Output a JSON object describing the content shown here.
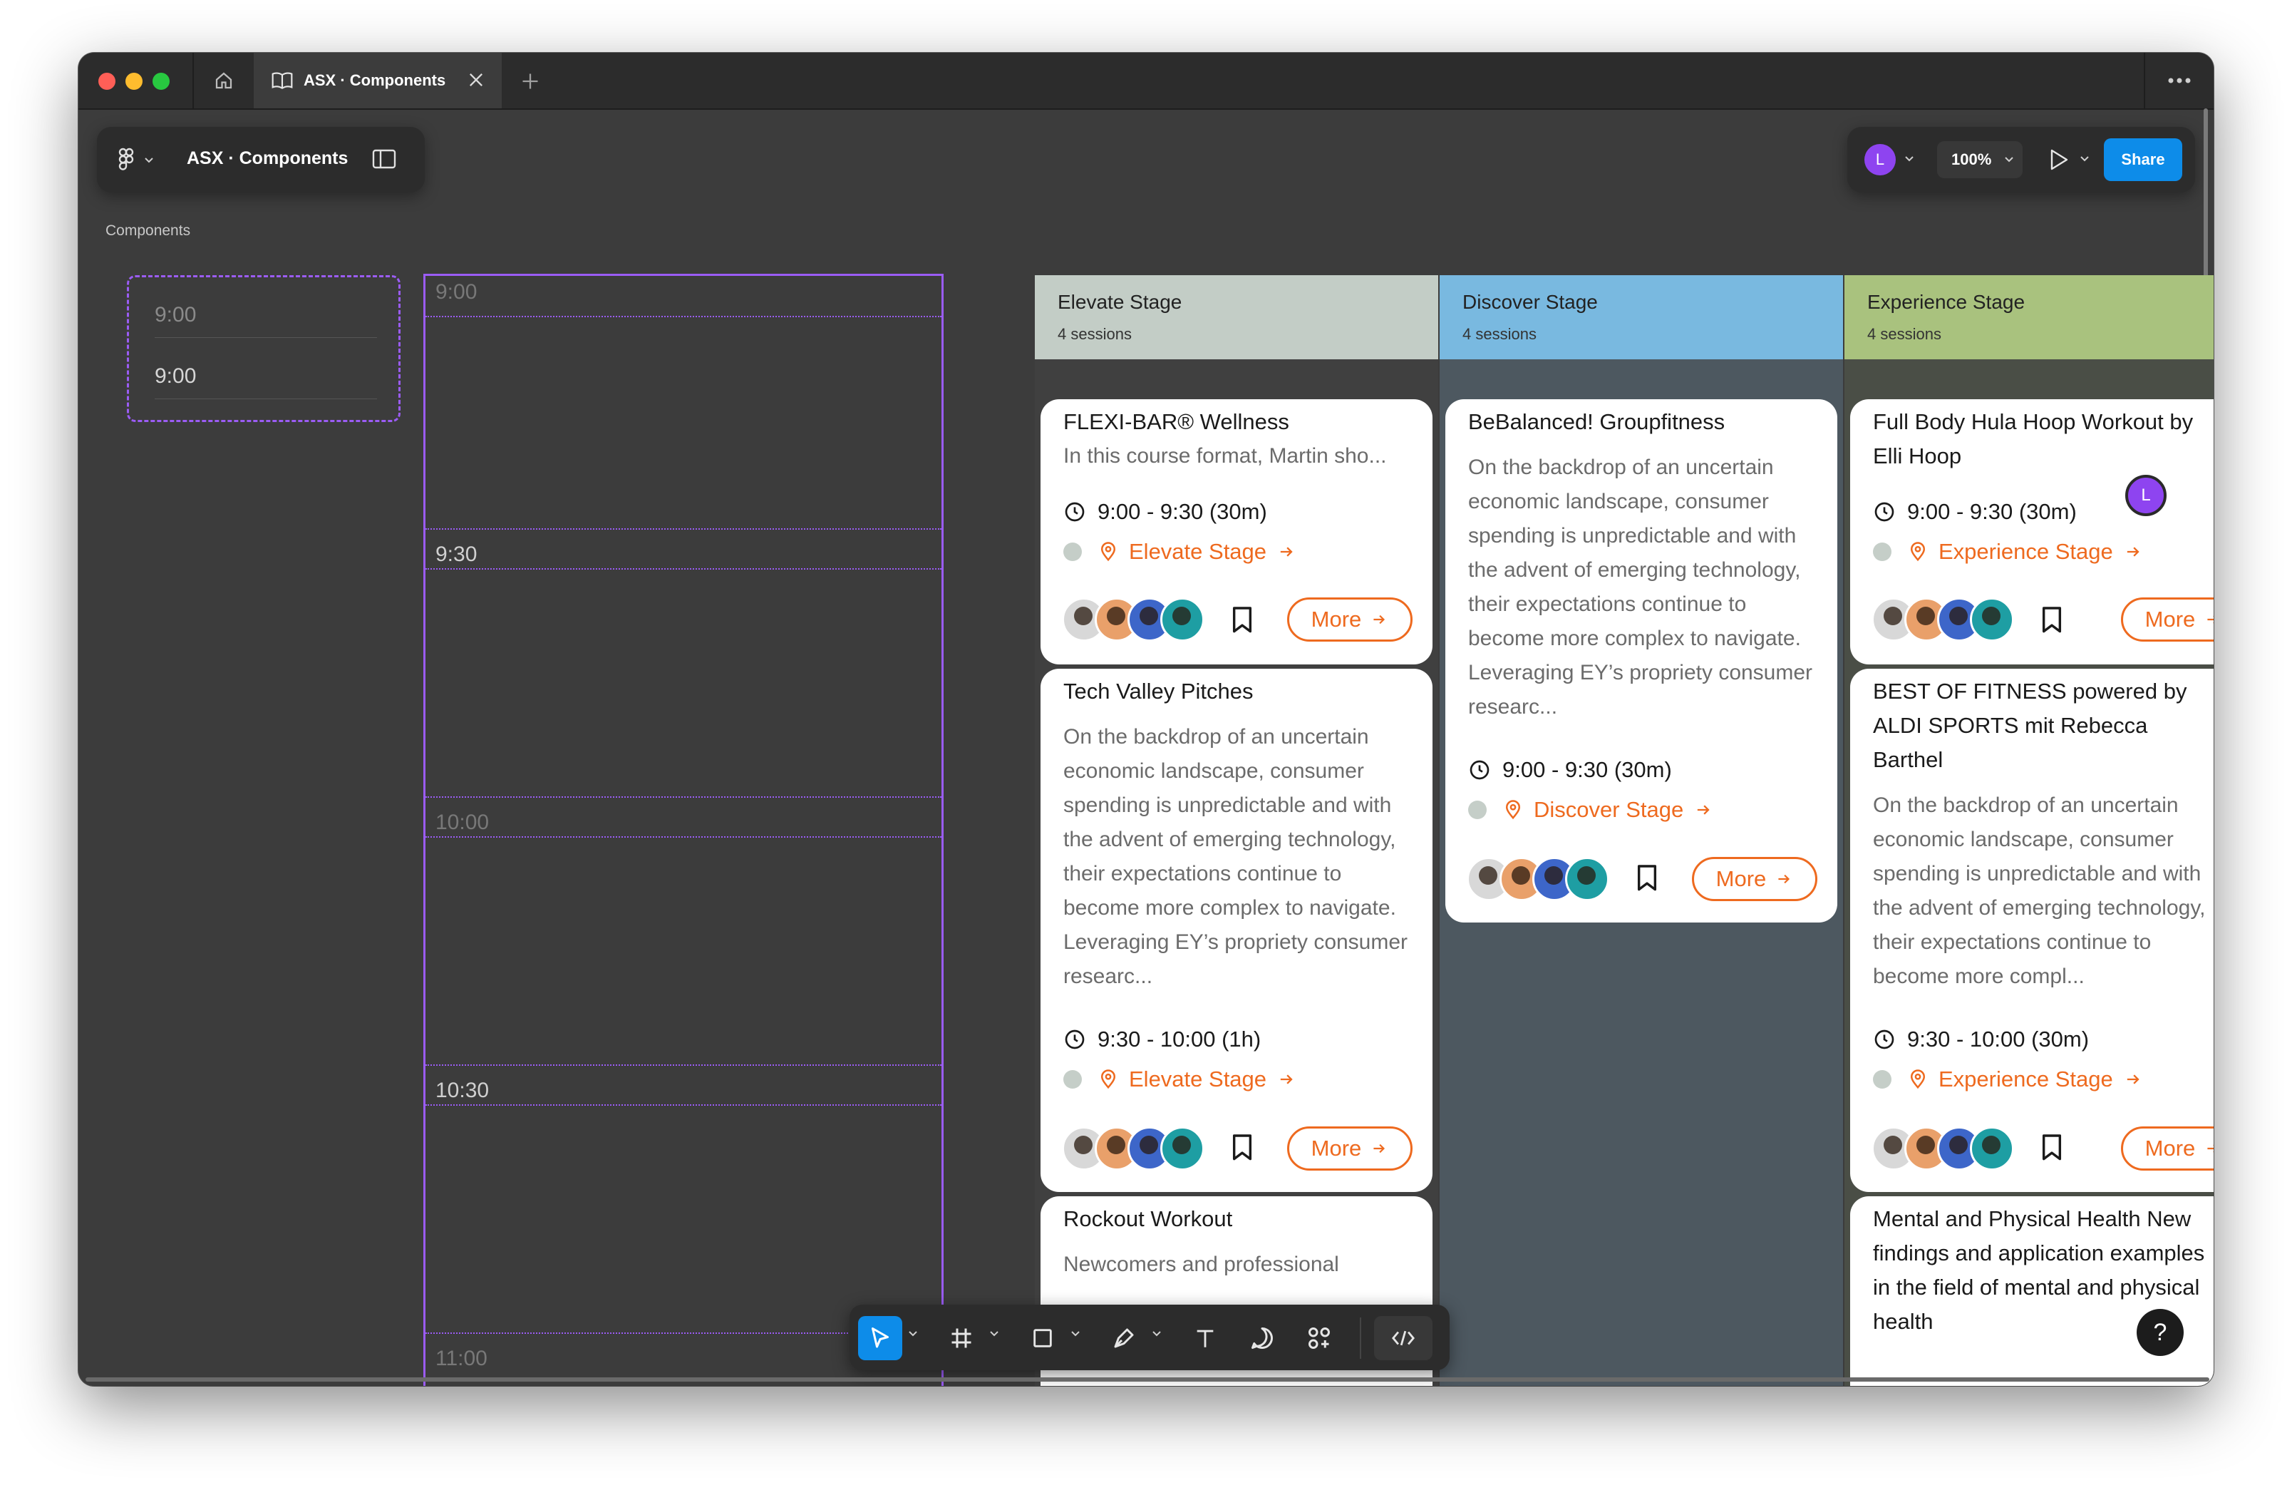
{
  "window": {
    "tab_title": "ASX · Components",
    "colors": {
      "close": "#ff5f57",
      "minimize": "#febc2e",
      "maximize": "#28c840",
      "accent": "#9b5cf5",
      "orange": "#ee6a1f",
      "share": "#0d8ce9"
    }
  },
  "toolbar": {
    "file_title": "ASX · Components",
    "avatar_initial": "L",
    "zoom": "100%",
    "share_label": "Share"
  },
  "canvas": {
    "section_label": "Components",
    "time_component": {
      "times": [
        "9:00",
        "9:00"
      ]
    },
    "grid_times": [
      "9:00",
      "9:30",
      "10:00",
      "10:30",
      "11:00"
    ]
  },
  "stages": [
    {
      "name": "Elevate Stage",
      "count": "4 sessions",
      "header_color": "#c3cdc6",
      "body_color": "#404040",
      "cards": [
        {
          "title": "FLEXI-BAR® Wellness",
          "description": "In this course format, Martin sho...",
          "time": "9:00 - 9:30 (30m)",
          "location": "Elevate Stage",
          "more": "More"
        },
        {
          "title": "Tech Valley Pitches",
          "description": "On the backdrop of an uncertain economic landscape, consumer spending is unpredictable and with the advent of emerging technology, their expectations continue to become more complex to navigate. Leveraging EY’s propriety consumer researc...",
          "time": "9:30 - 10:00 (1h)",
          "location": "Elevate Stage",
          "more": "More"
        },
        {
          "title": "Rockout Workout",
          "description": "Newcomers and professional"
        }
      ]
    },
    {
      "name": "Discover Stage",
      "count": "4 sessions",
      "header_color": "#79b9e0",
      "body_color": "#4d5860",
      "cards": [
        {
          "title": "BeBalanced! Groupfitness",
          "description": "On the backdrop of an uncertain economic landscape, consumer spending is unpredictable and with the advent of emerging technology, their expectations continue to become more complex to navigate. Leveraging EY’s propriety consumer researc...",
          "time": "9:00 - 9:30 (30m)",
          "location": "Discover Stage",
          "more": "More"
        }
      ]
    },
    {
      "name": "Experience Stage",
      "count": "4 sessions",
      "header_color": "#a9c27e",
      "body_color": "#4a4e46",
      "cards": [
        {
          "title": "Full Body Hula Hoop Workout by Elli Hoop",
          "time": "9:00 - 9:30 (30m)",
          "location": "Experience Stage",
          "more": "More"
        },
        {
          "title": "BEST OF FITNESS powered by ALDI SPORTS mit Rebecca Barthel",
          "description": "On the backdrop of an uncertain economic landscape, consumer spending is unpredictable and with the advent of emerging technology, their expectations continue to become more compl...",
          "time": "9:30 - 10:00 (30m)",
          "location": "Experience Stage",
          "more": "More"
        },
        {
          "title": "Mental and Physical Health New findings and application examples in the field of mental and physical health"
        }
      ]
    }
  ],
  "cursor_initial": "L",
  "help_label": "?"
}
